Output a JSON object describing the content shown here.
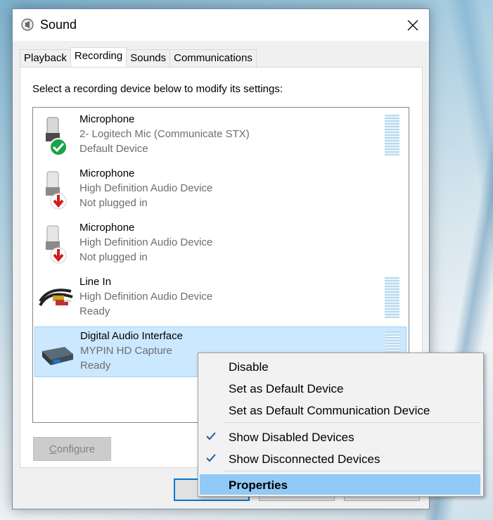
{
  "window": {
    "title": "Sound"
  },
  "tabs": [
    {
      "label": "Playback"
    },
    {
      "label": "Recording"
    },
    {
      "label": "Sounds"
    },
    {
      "label": "Communications"
    }
  ],
  "instruction": "Select a recording device below to modify its settings:",
  "devices": [
    {
      "name": "Microphone",
      "line2": "2- Logitech Mic (Communicate STX)",
      "line3": "Default Device",
      "icon": "microphone-default-icon"
    },
    {
      "name": "Microphone",
      "line2": "High Definition Audio Device",
      "line3": "Not plugged in",
      "icon": "microphone-unplugged-icon"
    },
    {
      "name": "Microphone",
      "line2": "High Definition Audio Device",
      "line3": "Not plugged in",
      "icon": "microphone-unplugged-icon"
    },
    {
      "name": "Line In",
      "line2": "High Definition Audio Device",
      "line3": "Ready",
      "icon": "line-in-cable-icon"
    },
    {
      "name": "Digital Audio Interface",
      "line2": "MYPIN HD Capture",
      "line3": "Ready",
      "icon": "capture-device-icon"
    }
  ],
  "buttons": {
    "configure": "Configure"
  },
  "context_menu": {
    "items": [
      {
        "label": "Disable",
        "checked": false
      },
      {
        "label": "Set as Default Device",
        "checked": false
      },
      {
        "label": "Set as Default Communication Device",
        "checked": false
      },
      {
        "label": "Show Disabled Devices",
        "checked": true
      },
      {
        "label": "Show Disconnected Devices",
        "checked": true
      },
      {
        "label": "Properties",
        "checked": false,
        "highlighted": true
      }
    ]
  },
  "colors": {
    "selection": "#cce8ff",
    "menu_highlight": "#91c9f7",
    "accent": "#0078d7"
  }
}
